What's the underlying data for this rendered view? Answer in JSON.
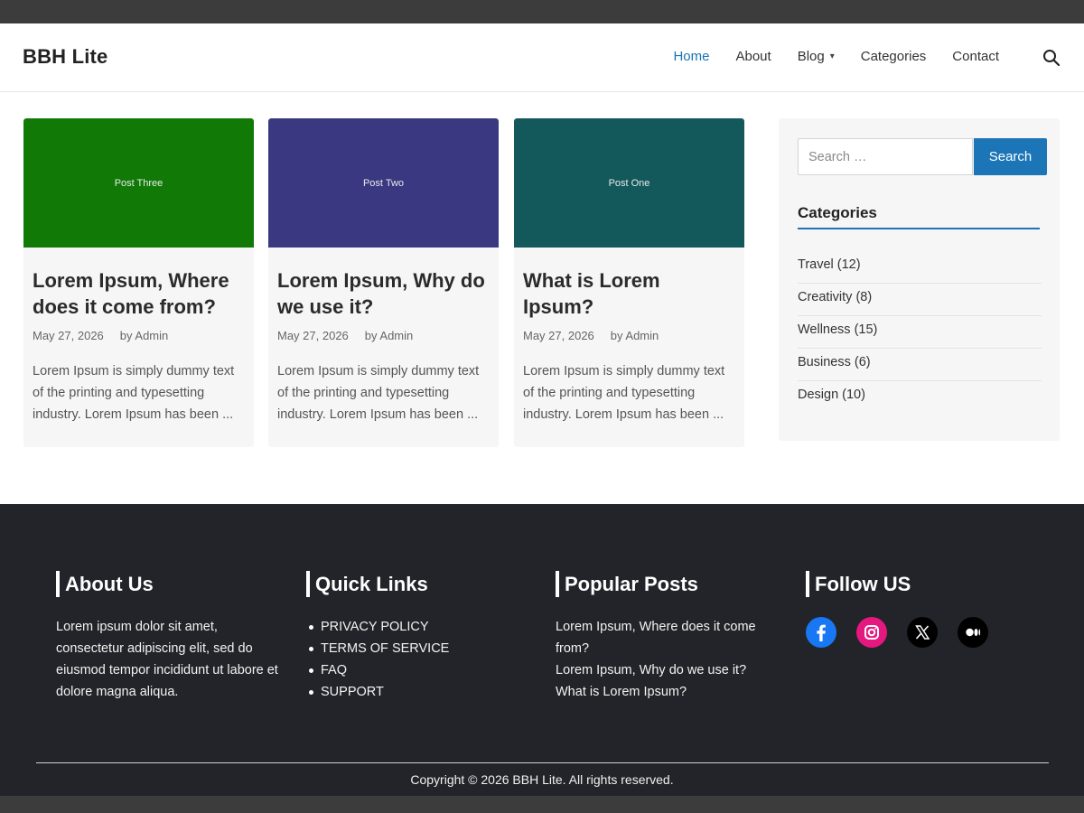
{
  "site": {
    "title": "BBH Lite"
  },
  "nav": {
    "items": [
      {
        "label": "Home",
        "active": true
      },
      {
        "label": "About"
      },
      {
        "label": "Blog",
        "has_dropdown": true
      },
      {
        "label": "Categories"
      },
      {
        "label": "Contact"
      }
    ],
    "search_icon": "search-icon",
    "dropdown_glyph": "▾"
  },
  "posts": [
    {
      "image_label": "Post Three",
      "image_color": "#117a07",
      "title": "Lorem Ipsum, Where does it come from?",
      "date": "May 27, 2026",
      "author": "by Admin",
      "excerpt": "Lorem Ipsum is simply dummy text of the printing and typesetting industry. Lorem Ipsum has been ..."
    },
    {
      "image_label": "Post Two",
      "image_color": "#393880",
      "title": "Lorem Ipsum, Why do we use it?",
      "date": "May 27, 2026",
      "author": "by Admin",
      "excerpt": "Lorem Ipsum is simply dummy text of the printing and typesetting industry. Lorem Ipsum has been ..."
    },
    {
      "image_label": "Post One",
      "image_color": "#13595c",
      "title": "What is Lorem Ipsum?",
      "date": "May 27, 2026",
      "author": "by Admin",
      "excerpt": "Lorem Ipsum is simply dummy text of the printing and typesetting industry. Lorem Ipsum has been ..."
    }
  ],
  "sidebar": {
    "search": {
      "placeholder": "Search …",
      "button_label": "Search"
    },
    "categories_heading": "Categories",
    "categories": [
      {
        "label": "Travel (12)"
      },
      {
        "label": "Creativity (8)"
      },
      {
        "label": "Wellness (15)"
      },
      {
        "label": "Business (6)"
      },
      {
        "label": "Design (10)"
      }
    ]
  },
  "footer": {
    "about": {
      "heading": "About Us",
      "text": "Lorem ipsum dolor sit amet, consectetur adipiscing elit, sed do eiusmod tempor incididunt ut labore et dolore magna aliqua."
    },
    "quick_links": {
      "heading": "Quick Links",
      "items": [
        {
          "label": "PRIVACY POLICY"
        },
        {
          "label": "TERMS OF SERVICE"
        },
        {
          "label": "FAQ"
        },
        {
          "label": "SUPPORT"
        }
      ]
    },
    "popular_posts": {
      "heading": "Popular Posts",
      "items": [
        {
          "label": "Lorem Ipsum, Where does it come from?"
        },
        {
          "label": "Lorem Ipsum, Why do we use it?"
        },
        {
          "label": "What is Lorem Ipsum?"
        }
      ]
    },
    "follow": {
      "heading": "Follow US",
      "items": [
        {
          "icon": "facebook-icon",
          "color": "#1877f2"
        },
        {
          "icon": "instagram-icon",
          "color": "#e4187f"
        },
        {
          "icon": "x-icon",
          "color": "#000000"
        },
        {
          "icon": "medium-icon",
          "color": "#000000"
        }
      ]
    },
    "copyright": "Copyright © 2026 BBH Lite. All rights reserved."
  },
  "colors": {
    "accent": "#1b75b6",
    "footer_bg": "#222429",
    "card_bg": "#f6f6f6"
  }
}
